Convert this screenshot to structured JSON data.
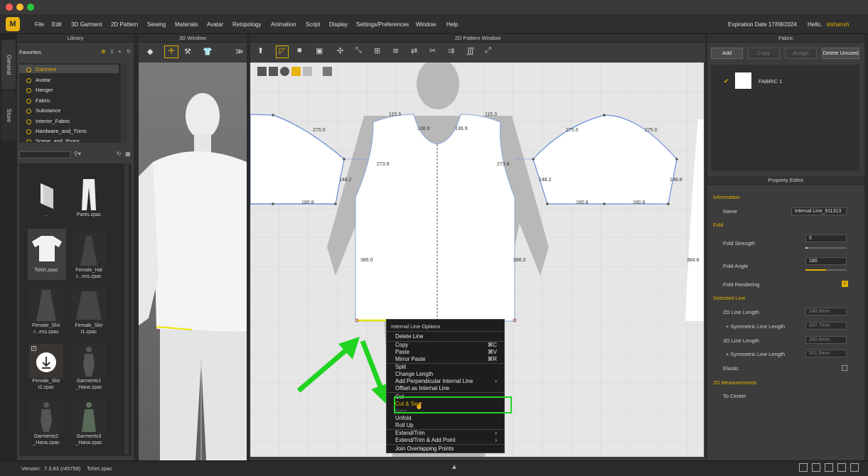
{
  "mac_buttons": {
    "close": "#ff5f57",
    "min": "#febc2e",
    "max": "#28c840"
  },
  "menus": [
    "File",
    "Edit",
    "3D Garment",
    "2D Pattern",
    "Sewing",
    "Materials",
    "Avatar",
    "Retopology",
    "Animation",
    "Script",
    "Display",
    "Settings/Preferences",
    "Window",
    "Help"
  ],
  "header": {
    "expiration": "Expiration Date 17/08/2024",
    "hello": "Hello,",
    "username": "kishanvh"
  },
  "side_tabs": {
    "general": "General",
    "store": "Store"
  },
  "library": {
    "title": "Library",
    "favorites_label": "Favorites",
    "favorites": [
      "Garment",
      "Avatar",
      "Hanger",
      "Fabric",
      "Substance",
      "Interior_Fabric",
      "Hardware_and_Trims",
      "Scene_and_Props"
    ],
    "items": [
      {
        "label": ".."
      },
      {
        "label": "Pants.zpac"
      },
      {
        "label": "Tshirt.zpac"
      },
      {
        "label": "Female_Hal t...ess.zpac"
      },
      {
        "label": "Female_Shir r...ess.zpac"
      },
      {
        "label": "Female_Skir t1.zpac"
      },
      {
        "label": "Female_Skir t2.zpac"
      },
      {
        "label": "Garments1 _Hana.zpac"
      },
      {
        "label": "Garments2 _Hana.zpac"
      },
      {
        "label": "Garments3 _Hana.zpac"
      }
    ]
  },
  "window3d": {
    "title": "3D Window"
  },
  "window2d": {
    "title": "2D Pattern Window"
  },
  "measurements": {
    "m1": "275.0",
    "m2": "275.0",
    "m3": "115.3",
    "m4": "115.3",
    "m5": "136.9",
    "m6": "136.9",
    "m7": "275.0",
    "m8": "275.0",
    "m9": "273.8",
    "m10": "273.8",
    "m11": "148.2",
    "m12": "148.2",
    "m13": "148.8",
    "m14": "180.8",
    "m15": "180.8",
    "m16": "180.8",
    "m17": "386.0",
    "m18": "386.0",
    "m19": "384.8",
    "m20": "148.8",
    "m21": "148.8"
  },
  "context_menu": {
    "header": "Internal Line Options",
    "items": [
      {
        "label": "Delete Line",
        "shortcut": ""
      },
      {
        "label": "Copy",
        "shortcut": "⌘C"
      },
      {
        "label": "Paste",
        "shortcut": "⌘V"
      },
      {
        "label": "Mirror Paste",
        "shortcut": "⌘R"
      },
      {
        "label": "Split",
        "shortcut": ""
      },
      {
        "label": "Change Length",
        "shortcut": ""
      },
      {
        "label": "Add Perpendicular Internal Line",
        "shortcut": "›"
      },
      {
        "label": "Offset as Internal Line",
        "shortcut": ""
      },
      {
        "label": "Cut",
        "shortcut": ""
      },
      {
        "label": "Cut & Sew",
        "shortcut": ""
      },
      {
        "label": "Hem",
        "shortcut": ""
      },
      {
        "label": "Unfold",
        "shortcut": ""
      },
      {
        "label": "Roll Up",
        "shortcut": ""
      },
      {
        "label": "Extend/Trim",
        "shortcut": "›"
      },
      {
        "label": "Extend/Trim & Add Point",
        "shortcut": "›"
      },
      {
        "label": "Join Overlapping Points",
        "shortcut": ""
      }
    ]
  },
  "fabric": {
    "title": "Fabric",
    "add": "Add",
    "copy": "Copy",
    "assign": "Assign",
    "delete_unused": "Delete Unused",
    "fabric1": "FABRIC 1"
  },
  "property": {
    "title": "Property Editor",
    "information": "Information",
    "name_label": "Name",
    "name_value": "Internal Line_911313",
    "fold": "Fold",
    "fold_strength_label": "Fold Strength",
    "fold_strength_value": "5",
    "fold_strength_level": 0.05,
    "fold_angle_label": "Fold Angle",
    "fold_angle_value": "180",
    "fold_angle_level": 0.5,
    "fold_rendering_label": "Fold Rendering",
    "selected_line": "Selected Line",
    "len2d_label": "2D Line Length",
    "len2d_value": "248.8mm",
    "sym2d_label": "+ Symmetric Line Length",
    "sym2d_value": "497.7mm",
    "len3d_label": "3D Line Length",
    "len3d_value": "250.6mm",
    "sym3d_label": "+ Symmetric Line Length",
    "sym3d_value": "501.9mm",
    "elastic_label": "Elastic",
    "measurements2d": "2D Measurements",
    "to_center": "To Center"
  },
  "status": {
    "version_label": "Version:",
    "version": "7.3.83 (r45759)",
    "file": "Tshirt.zpac"
  },
  "colors": {
    "accent": "#e0b000",
    "highlight": "#21d321",
    "pattern_line": "#6a8fd8"
  }
}
